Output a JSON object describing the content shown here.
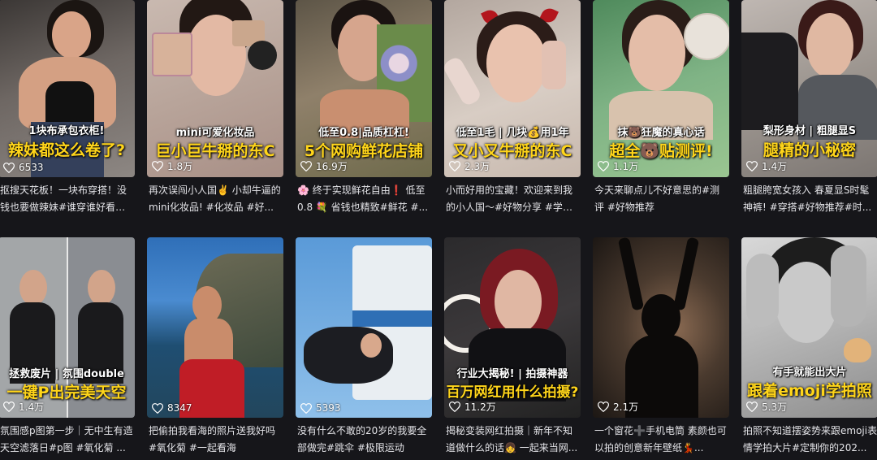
{
  "cards": [
    {
      "cap1": "1块布承包衣柜!",
      "cap2": "辣妹都这么卷了?",
      "likes": "6533",
      "desc": "抠搜天花板！一块布穿搭！没钱也要做辣妹#谁穿谁好看 #..."
    },
    {
      "cap1": "mini可爱化妆品",
      "cap2": "巨小巨牛掰的东C",
      "likes": "1.8万",
      "desc": "再次误闯小人国✌️ 小却牛逼的mini化妆品! #化妆品 #好..."
    },
    {
      "cap1": "低至0.8|品质杠杠!",
      "cap2": "5个网购鲜花店铺",
      "likes": "16.9万",
      "desc": "🌸 终于实现鲜花自由❗ 低至0.8 💐 省钱也精致#鲜花 #..."
    },
    {
      "cap1": "低至1毛 | 几块💰用1年",
      "cap2": "又小又牛掰的东C",
      "likes": "2.3万",
      "desc": "小而好用的宝藏！欢迎来到我的小人国～#好物分享 #学生..."
    },
    {
      "cap1": "抹🐻狂魔的真心话",
      "cap2": "超全🐻贴测评!",
      "likes": "1.1万",
      "desc": "今天来聊点儿不好意思的#测评 #好物推荐"
    },
    {
      "cap1": "梨形身材 | 粗腿显S",
      "cap2": "腿精的小秘密",
      "likes": "1.4万",
      "desc": "粗腿胯宽女孩入 春夏显S时髦神裤! #穿搭#好物推荐#时..."
    },
    {
      "cap1": "拯救废片 | 氛围double",
      "cap2": "一键P出完美天空",
      "likes": "1.4万",
      "desc": "氛围感p图第一步｜无中生有造天空滤落日#p图 #氧化菊 ..."
    },
    {
      "cap1": "",
      "cap2": "",
      "likes": "8347",
      "desc": "把偷拍我看海的照片送我好吗#氧化菊 #一起看海"
    },
    {
      "cap1": "",
      "cap2": "",
      "likes": "5393",
      "desc": "没有什么不敢的20岁的我要全部做完#跳伞 #极限运动"
    },
    {
      "cap1": "行业大揭秘! | 拍摄神器",
      "cap2": "百万网红用什么拍摄?",
      "likes": "11.2万",
      "desc": "揭秘变装网红拍摄｜新年不知道做什么的话👧 一起来当网..."
    },
    {
      "cap1": "",
      "cap2": "",
      "likes": "2.1万",
      "desc": "一个窗花➕手机电筒 素颜也可以拍的创意新年壁纸💃..."
    },
    {
      "cap1": "有手就能出大片",
      "cap2": "跟着emoji学拍照",
      "likes": "5.3万",
      "desc": "拍照不知道摆姿势来跟emoji表情学拍大片#定制你的202..."
    }
  ],
  "colors": {
    "background": "#16161a",
    "cap_yellow": "#ffd51a",
    "cap_white": "#ffffff"
  },
  "icons": {
    "like": "heart-outline-icon"
  }
}
